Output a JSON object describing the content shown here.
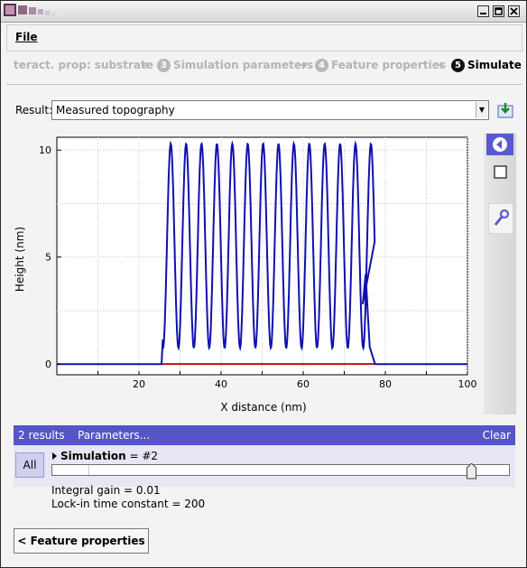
{
  "menu": {
    "file_label": "File"
  },
  "steps": [
    {
      "num": "",
      "label": "teract. prop: substrate",
      "active": false
    },
    {
      "num": "3",
      "label": "Simulation parameters",
      "active": false
    },
    {
      "num": "4",
      "label": "Feature properties",
      "active": false
    },
    {
      "num": "5",
      "label": "Simulate",
      "active": true
    }
  ],
  "result": {
    "label": "Result:",
    "selected": "Measured topography"
  },
  "chart_data": {
    "type": "line",
    "xlabel": "X distance (nm)",
    "ylabel": "Height (nm)",
    "xlim": [
      0,
      100
    ],
    "ylim": [
      -0.5,
      10.6
    ],
    "x_ticks": [
      "20",
      "40",
      "60",
      "80",
      "100"
    ],
    "y_ticks": [
      "0",
      "5",
      "10"
    ],
    "grid": true,
    "series": [
      {
        "color": "#1010b0",
        "peak_count": 14,
        "x_start": 25.5,
        "x_end": 77.5,
        "period": 3.75,
        "peak_height": 10.3,
        "valley_height": 0.75,
        "baseline": 0.0
      },
      {
        "color": "#c01010",
        "x": [
          25.5,
          77.5
        ],
        "y": [
          0,
          0
        ]
      }
    ]
  },
  "results_panel": {
    "count": "2 results",
    "parameters": "Parameters...",
    "clear": "Clear",
    "all": "All",
    "sim_name": "Simulation",
    "sim_value": "= #2",
    "slider_fraction": 0.915,
    "integral_gain": "Integral gain = 0.01",
    "lockin": "Lock-in time constant = 200"
  },
  "nav": {
    "back_label": "< Feature properties"
  },
  "colors": {
    "accent": "#5555c6",
    "line": "#1010b0",
    "baseline": "#c01010"
  }
}
